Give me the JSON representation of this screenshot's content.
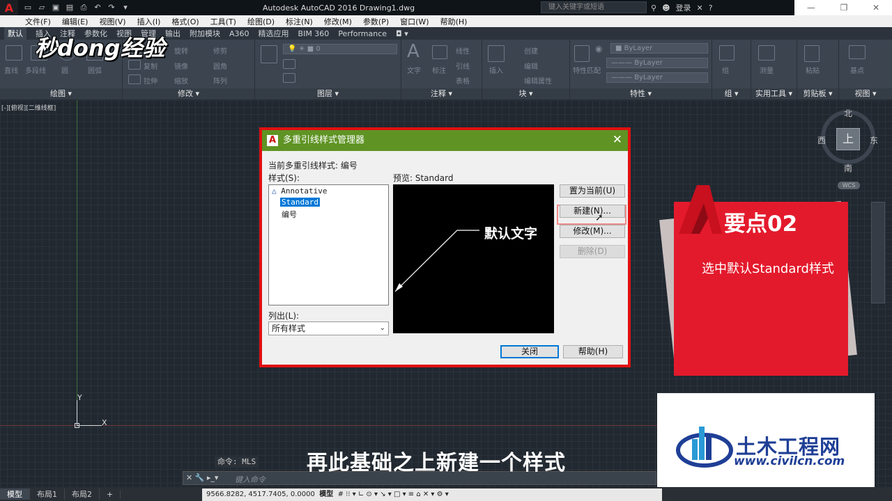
{
  "window": {
    "title": "Autodesk AutoCAD 2016    Drawing1.dwg",
    "search_placeholder": "键入关键字或短语",
    "login": "登录",
    "help": "?"
  },
  "menu": [
    "文件(F)",
    "编辑(E)",
    "视图(V)",
    "插入(I)",
    "格式(O)",
    "工具(T)",
    "绘图(D)",
    "标注(N)",
    "修改(M)",
    "参数(P)",
    "窗口(W)",
    "帮助(H)"
  ],
  "ribbon_tabs": [
    "默认",
    "插入",
    "注释",
    "参数化",
    "视图",
    "管理",
    "输出",
    "附加模块",
    "A360",
    "精选应用",
    "BIM 360",
    "Performance"
  ],
  "ribbon_panels": [
    "绘图",
    "修改",
    "图层",
    "注释",
    "块",
    "特性",
    "组",
    "实用工具",
    "剪贴板",
    "视图"
  ],
  "ribbon": {
    "layer_value": "0",
    "bylayer": [
      "ByLayer",
      "ByLayer",
      "ByLayer"
    ],
    "draw_tools": [
      "直线",
      "多段线",
      "圆",
      "圆弧"
    ],
    "modify_tools": [
      "移动",
      "旋转",
      "修剪",
      "复制",
      "镜像",
      "圆角",
      "拉伸",
      "缩放",
      "阵列"
    ],
    "annot_tools": [
      "文字",
      "标注",
      "线性",
      "引线",
      "表格"
    ],
    "block_tools": [
      "插入",
      "创建",
      "编辑",
      "编辑属性"
    ],
    "prop_tools": [
      "特性匹配"
    ],
    "other_tools": [
      "组",
      "测量",
      "粘贴",
      "基点"
    ]
  },
  "viewport_label": "[-][俯视][二维线框]",
  "viewcube": {
    "north": "北",
    "south": "南",
    "east": "东",
    "west": "西",
    "top": "上",
    "wcs": "WCS"
  },
  "ucs": {
    "x": "X",
    "y": "Y"
  },
  "dialog": {
    "title": "多重引线样式管理器",
    "current_style_label": "当前多重引线样式: 编号",
    "styles_label": "样式(S):",
    "styles": [
      "Annotative",
      "Standard",
      "编号"
    ],
    "selected_style": "Standard",
    "preview_label": "预览: Standard",
    "preview_text": "默认文字",
    "list_label": "列出(L):",
    "list_value": "所有样式",
    "buttons": {
      "set_current": "置为当前(U)",
      "new": "新建(N)...",
      "modify": "修改(M)...",
      "delete": "删除(D)",
      "close": "关闭",
      "help": "帮助(H)"
    }
  },
  "key_point": {
    "title": "要点02",
    "description": "选中默认Standard样式"
  },
  "watermark": "秒dong经验",
  "brand": {
    "name": "土木工程网",
    "url": "www.civilcn.com"
  },
  "command": {
    "last": "命令: MLS",
    "placeholder": "键入命令"
  },
  "subtitle": "再此基础之上新建一个样式",
  "layout_tabs": [
    "模型",
    "布局1",
    "布局2"
  ],
  "status": {
    "coords": "9566.8282, 4517.7405, 0.0000",
    "mode": "模型"
  },
  "colors": {
    "dialog_title": "#5f9424",
    "highlight": "#e01010",
    "card": "#e31a2c",
    "brand": "#1f3f96"
  }
}
